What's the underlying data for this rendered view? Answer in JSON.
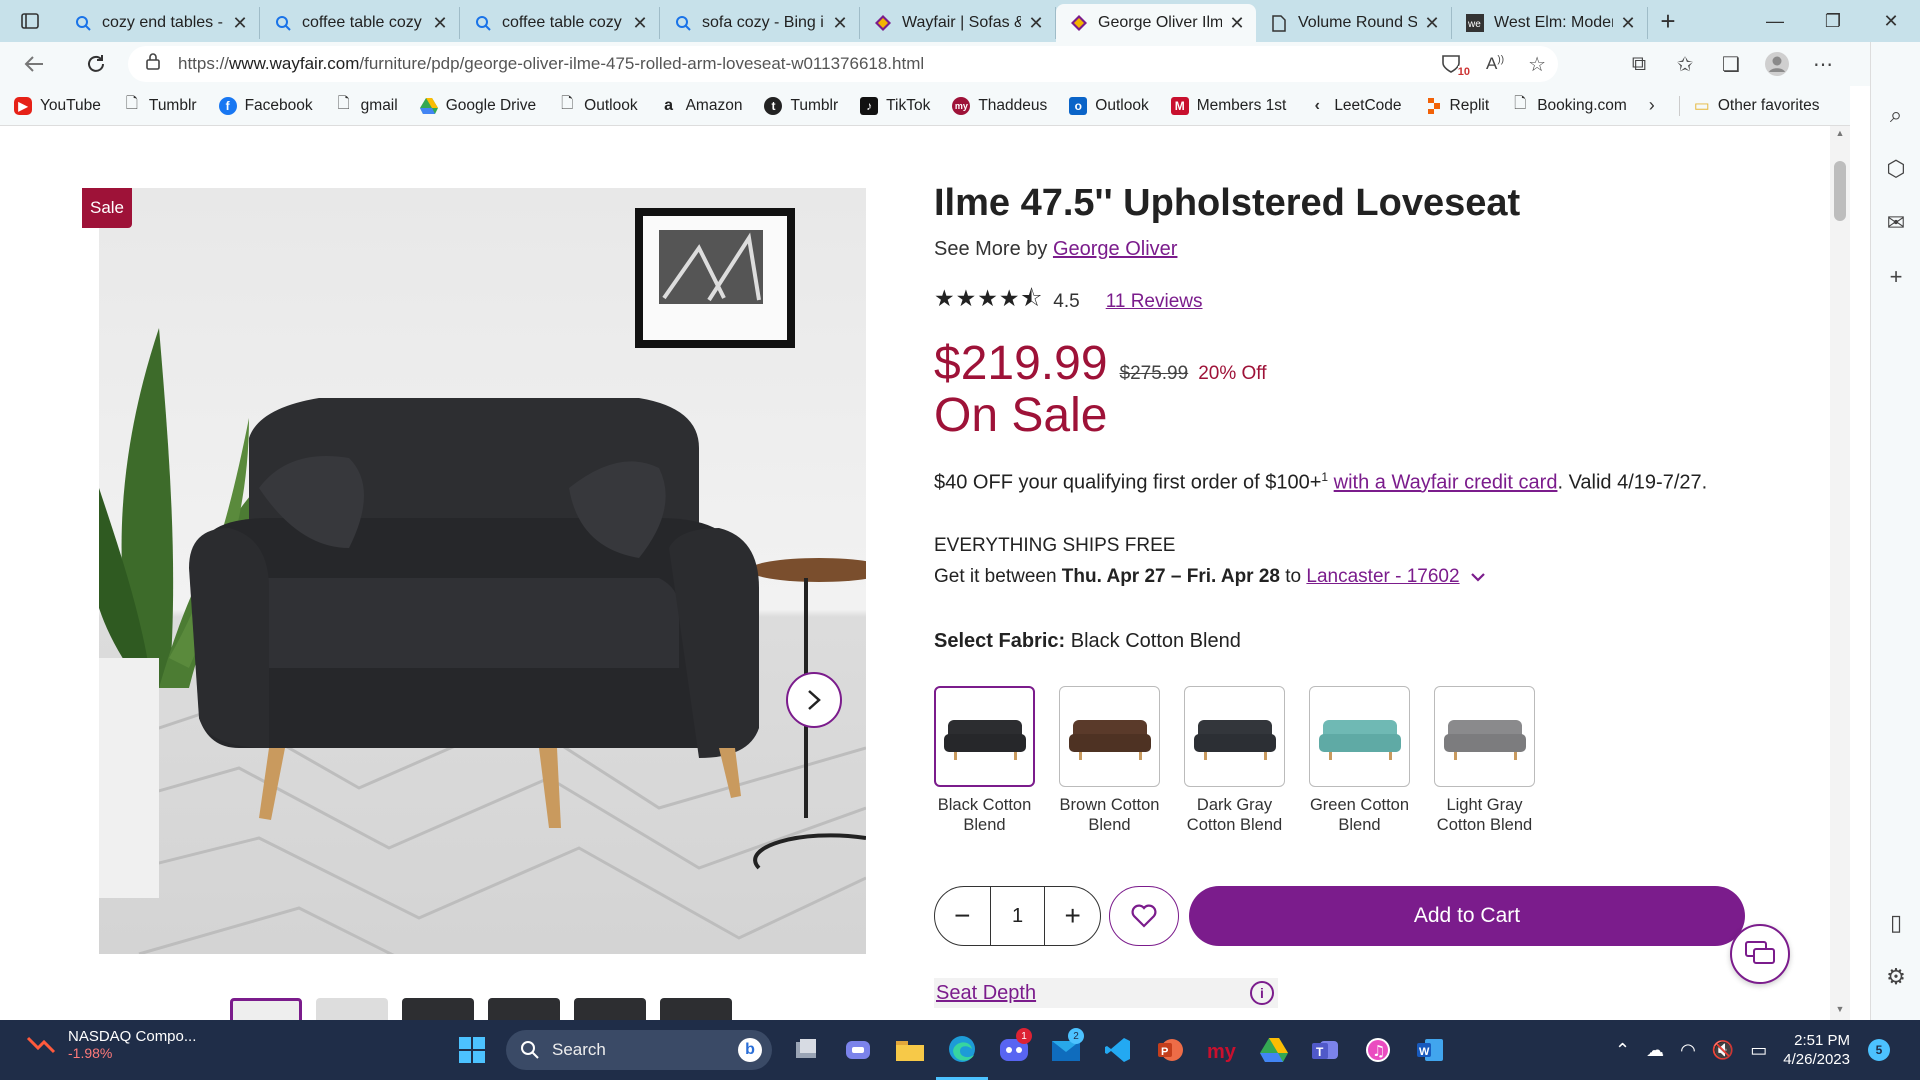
{
  "browser": {
    "tabs": [
      {
        "title": "cozy end tables -",
        "icon": "search-icon"
      },
      {
        "title": "coffee table cozy",
        "icon": "search-icon"
      },
      {
        "title": "coffee table cozy",
        "icon": "search-icon"
      },
      {
        "title": "sofa cozy - Bing in",
        "icon": "search-icon"
      },
      {
        "title": "Wayfair | Sofas &",
        "icon": "wayfair-icon"
      },
      {
        "title": "George Oliver Ilm",
        "icon": "wayfair-icon"
      },
      {
        "title": "Volume Round St",
        "icon": "page-icon"
      },
      {
        "title": "West Elm: Modern",
        "icon": "westelm-icon"
      }
    ],
    "active_tab": 5,
    "url_prefix": "https://",
    "url_host": "www.wayfair.com",
    "url_path": "/furniture/pdp/george-oliver-ilme-475-rolled-arm-loveseat-w011376618.html",
    "tracker_count": "10",
    "bookmarks": [
      "YouTube",
      "Tumblr",
      "Facebook",
      "gmail",
      "Google Drive",
      "Outlook",
      "Amazon",
      "Tumblr",
      "TikTok",
      "Thaddeus",
      "Outlook",
      "Members 1st",
      "LeetCode",
      "Replit",
      "Booking.com"
    ],
    "other_favorites": "Other favorites"
  },
  "product": {
    "sale_badge": "Sale",
    "title": "Ilme 47.5'' Upholstered Loveseat",
    "see_more_prefix": "See More by ",
    "brand": "George Oliver",
    "stars": "★★★★⯪",
    "rating": "4.5",
    "reviews": "11 Reviews",
    "price": "$219.99",
    "old_price": "$275.99",
    "discount": "20% Off",
    "on_sale": "On Sale",
    "promo_text": "$40 OFF your qualifying first order of $100+",
    "promo_sup": "1",
    "promo_link": "with a Wayfair credit card",
    "promo_valid": ". Valid 4/19-7/27.",
    "shipping_headline": "EVERYTHING SHIPS FREE",
    "delivery_prefix": "Get it between ",
    "delivery_dates": "Thu. Apr 27 – Fri. Apr 28",
    "delivery_to": " to ",
    "location": "Lancaster - 17602",
    "fabric_label": "Select Fabric:",
    "fabric_selected": "Black Cotton Blend",
    "fabrics": [
      {
        "name": "Black Cotton Blend",
        "color": "#2c2d30"
      },
      {
        "name": "Brown Cotton Blend",
        "color": "#5a3a2a"
      },
      {
        "name": "Dark Gray Cotton Blend",
        "color": "#33363b"
      },
      {
        "name": "Green Cotton Blend",
        "color": "#6fb9b4"
      },
      {
        "name": "Light Gray Cotton Blend",
        "color": "#8a8a8c"
      }
    ],
    "quantity": "1",
    "add_to_cart": "Add to Cart",
    "seat_depth": "Seat Depth"
  },
  "taskbar": {
    "stock_name": "NASDAQ Compo...",
    "stock_change": "-1.98%",
    "search": "Search",
    "time": "2:51 PM",
    "date": "4/26/2023",
    "notifications": "5",
    "discord_badge": "1",
    "mail_badge": "2"
  },
  "colors": {
    "accent": "#7b1c8c",
    "sale": "#9e1238",
    "tabstrip": "#c7e1ea"
  }
}
